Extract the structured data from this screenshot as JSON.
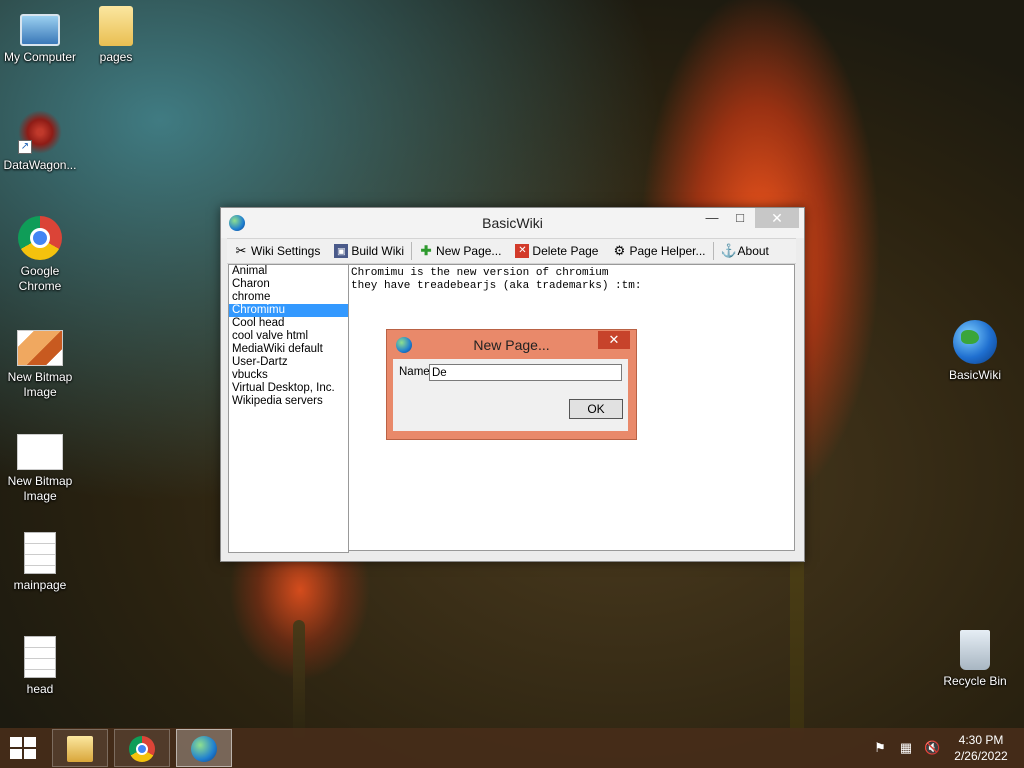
{
  "desktop": {
    "icons": [
      {
        "label": "My Computer"
      },
      {
        "label": "pages"
      },
      {
        "label": "DataWagon..."
      },
      {
        "label": "Google Chrome"
      },
      {
        "label": "New Bitmap Image"
      },
      {
        "label": "New Bitmap Image"
      },
      {
        "label": "mainpage"
      },
      {
        "label": "head"
      },
      {
        "label": "BasicWiki"
      },
      {
        "label": "Recycle Bin"
      }
    ]
  },
  "window": {
    "title": "BasicWiki",
    "minimize": "—",
    "maximize": "□",
    "close": "✕",
    "toolbar": {
      "wiki_settings": "Wiki Settings",
      "build_wiki": "Build Wiki",
      "new_page": "New Page...",
      "delete_page": "Delete Page",
      "page_helper": "Page Helper...",
      "about": "About"
    },
    "pages": [
      "Animal",
      "Charon",
      "chrome",
      "Chromimu",
      "Cool head",
      "cool valve html",
      "MediaWiki default",
      "User-Dartz",
      "vbucks",
      "Virtual Desktop, Inc.",
      "Wikipedia servers"
    ],
    "selected_page": "Chromimu",
    "editor_lines": [
      "Chromimu is the new version of chromium",
      "they have treadebearjs (aka trademarks) :tm:"
    ]
  },
  "dialog": {
    "title": "New Page...",
    "close": "✕",
    "name_label": "Name",
    "name_value": "De",
    "ok_label": "OK"
  },
  "taskbar": {
    "time": "4:30 PM",
    "date": "2/26/2022"
  }
}
